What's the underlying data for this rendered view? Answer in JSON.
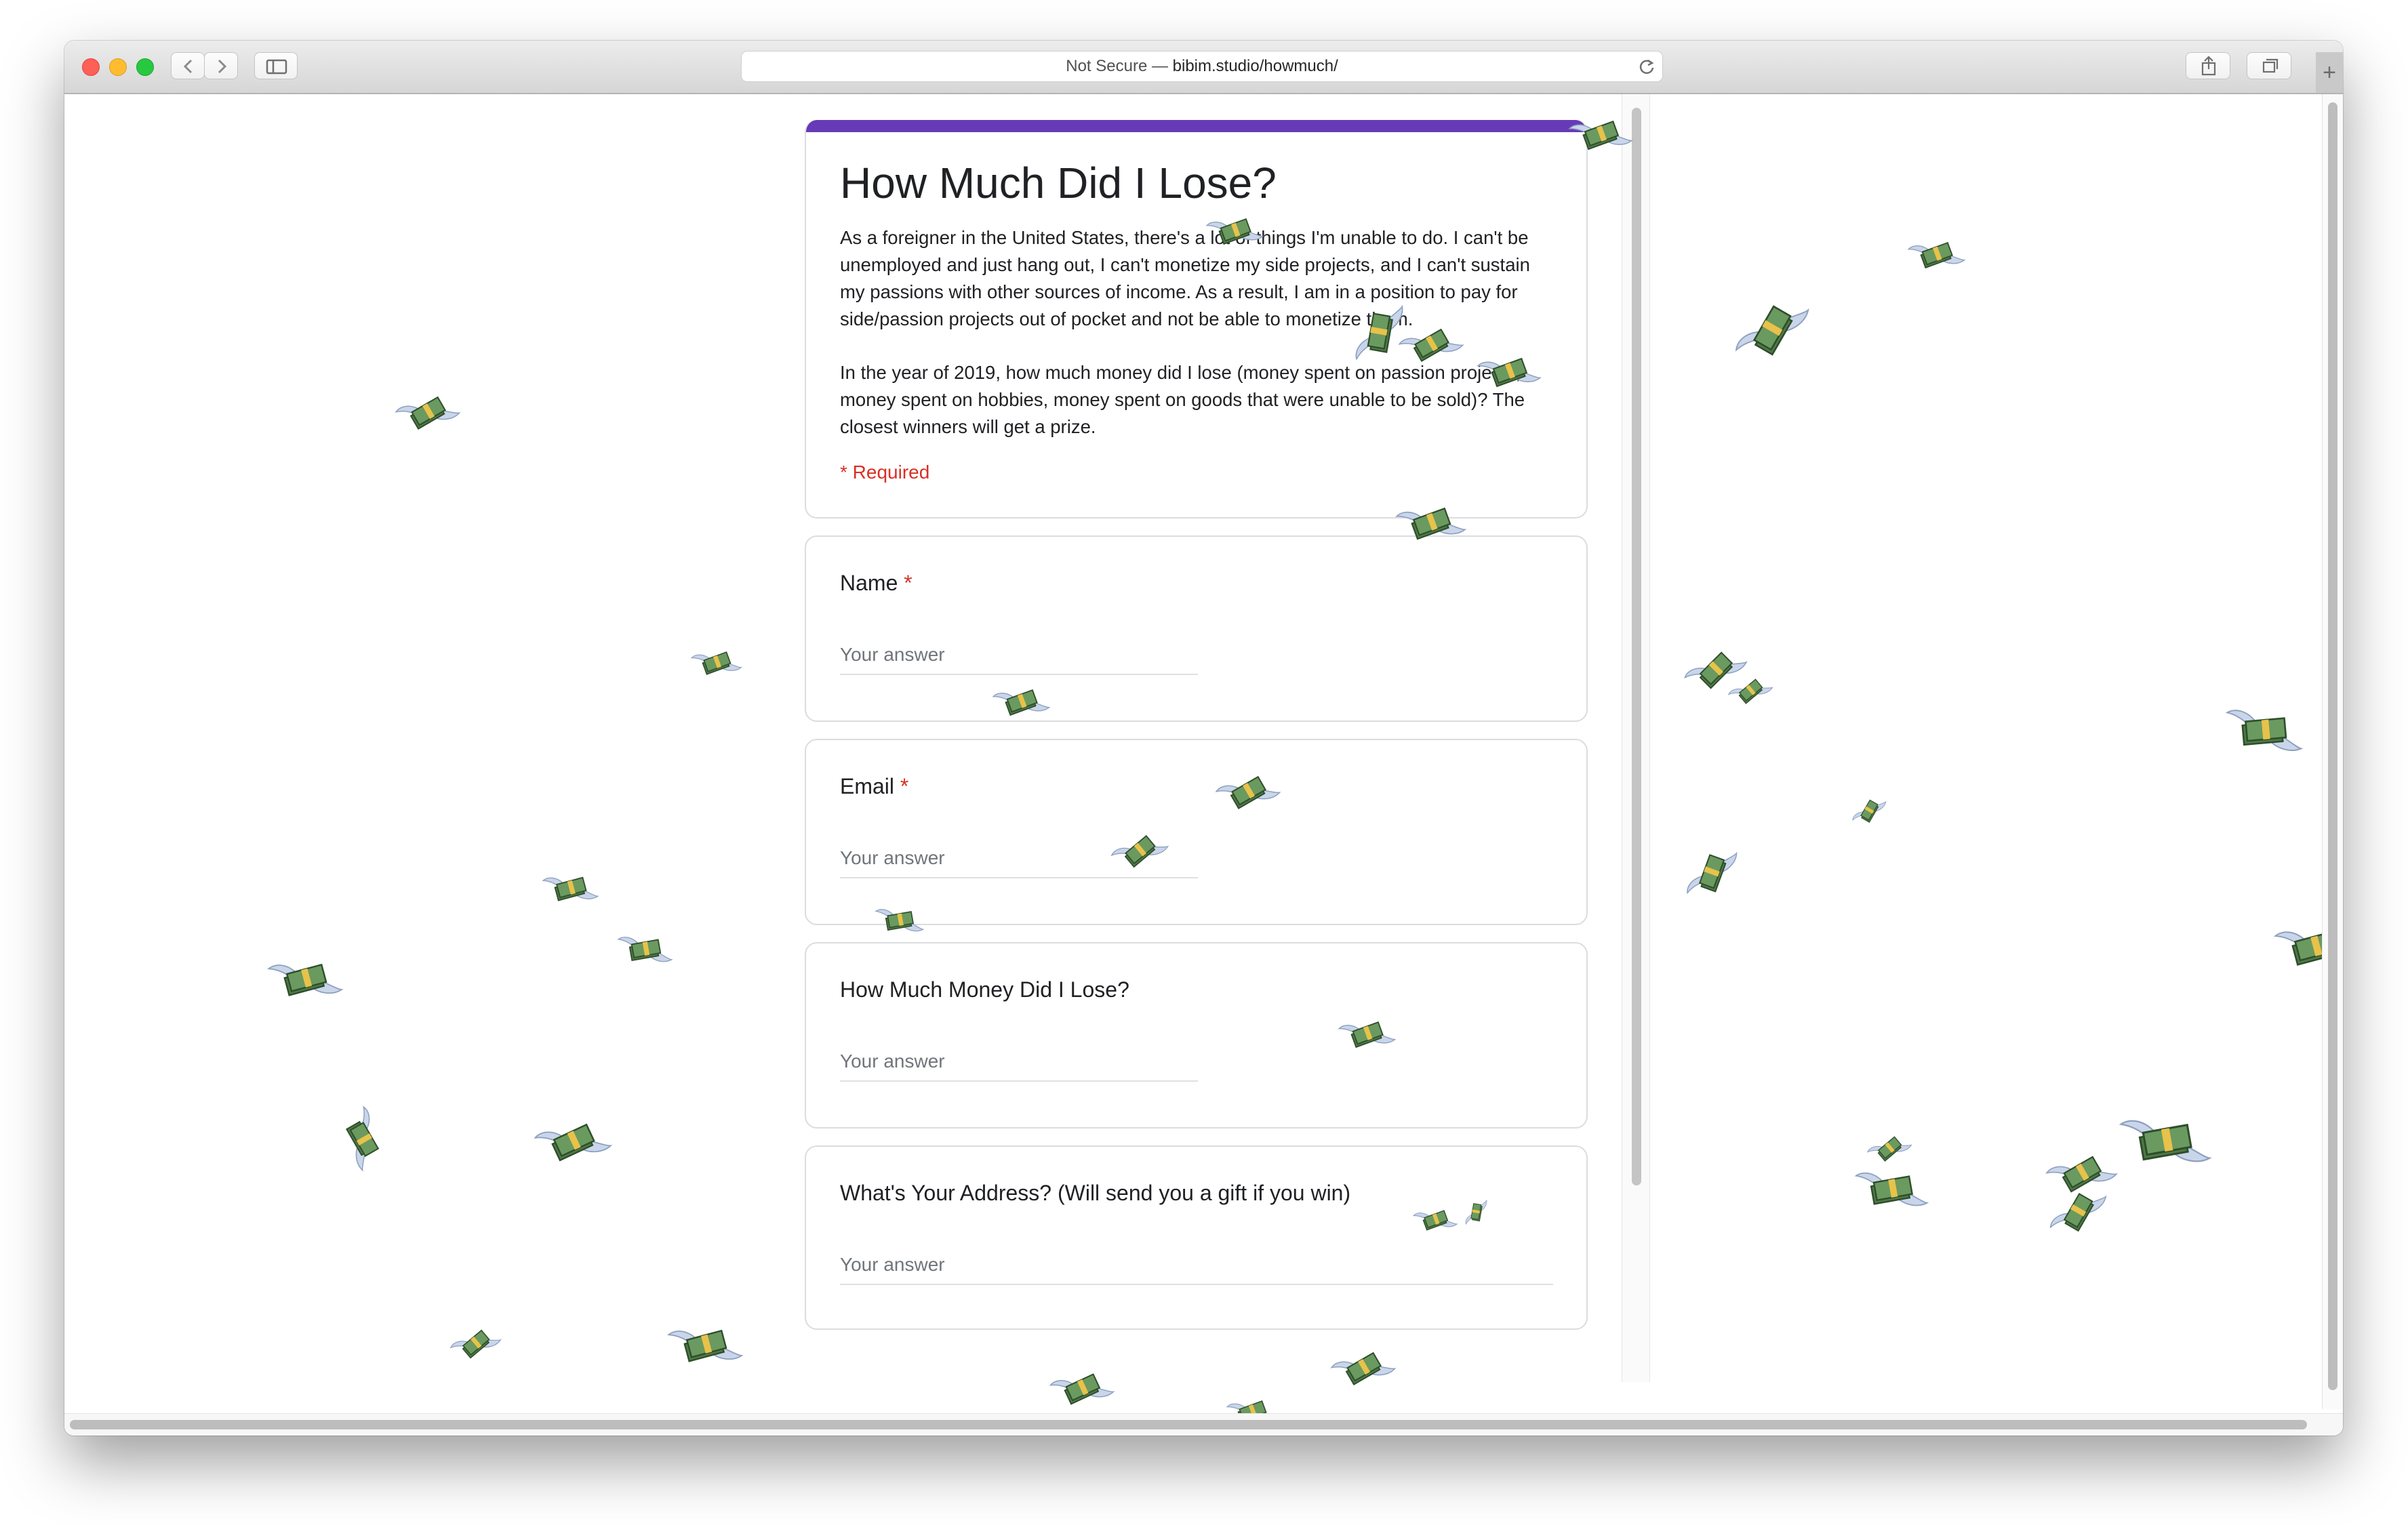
{
  "browser": {
    "address_prefix": "Not Secure — ",
    "address_host": "bibim.studio/howmuch/",
    "new_tab_symbol": "+",
    "icons": [
      "back-icon",
      "forward-icon",
      "sidebar-icon",
      "reload-icon",
      "share-icon",
      "tabs-overview-icon"
    ]
  },
  "form": {
    "accent_color": "#673ab7",
    "title": "How Much Did I Lose?",
    "description": [
      "As a foreigner in the United States, there's a lot of things I'm unable to do. I can't be unemployed and just hang out, I can't monetize my side projects, and I can't sustain my passions with other sources of income. As a result, I am in a position to pay for side/passion projects out of pocket and not be able to monetize them.",
      "In the year of 2019, how much money did I lose (money spent on passion projects, money spent on hobbies, money spent on goods that were unable to be sold)? The closest winners will get a prize."
    ],
    "required_note": "* Required",
    "questions": [
      {
        "title": "Name",
        "required_mark": "*",
        "placeholder": "Your answer"
      },
      {
        "title": "Email",
        "required_mark": "*",
        "placeholder": "Your answer"
      },
      {
        "title": "How Much Money Did I Lose?",
        "required_mark": "",
        "placeholder": "Your answer"
      },
      {
        "title": "What's Your Address? (Will send you a gift if you win)",
        "required_mark": "",
        "placeholder": "Your answer"
      }
    ]
  },
  "decorations": {
    "flying_money_icon": "winged-money-icon",
    "money_color": "#4e7a47",
    "band_color": "#e8c24a",
    "wing_color": "#c9d6ea"
  }
}
